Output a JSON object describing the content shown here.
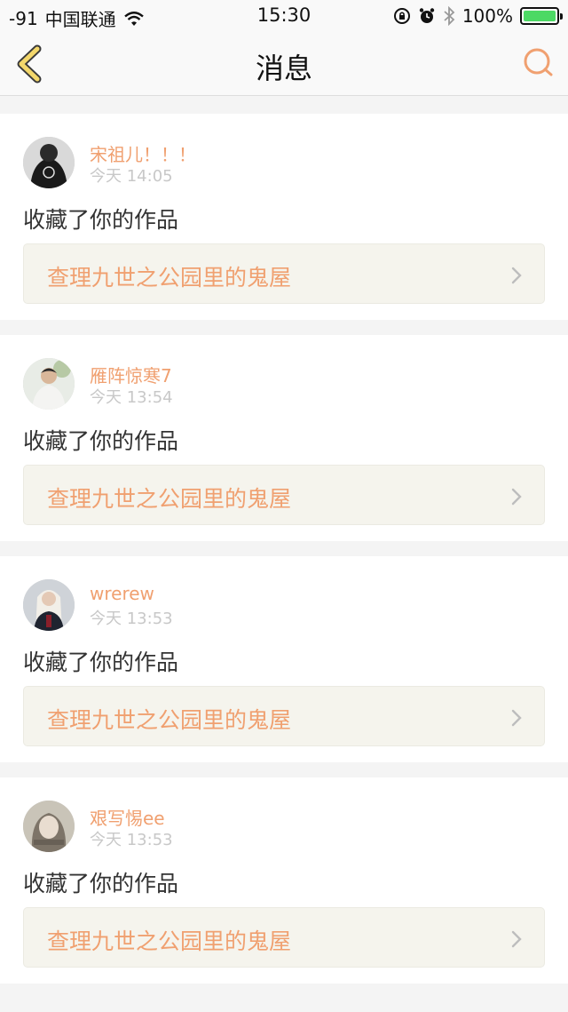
{
  "status": {
    "signal": "-91",
    "carrier": "中国联通",
    "time": "15:30",
    "battery": "100%",
    "battery_level": 1.0
  },
  "nav": {
    "title": "消息",
    "accent": "#f0a070"
  },
  "messages": [
    {
      "user": "宋祖儿！！！",
      "time": "今天 14:05",
      "action": "收藏了你的作品",
      "work": "查理九世之公园里的鬼屋"
    },
    {
      "user": "雁阵惊寒7",
      "time": "今天 13:54",
      "action": "收藏了你的作品",
      "work": "查理九世之公园里的鬼屋"
    },
    {
      "user": "wrerew",
      "time": "今天 13:53",
      "action": "收藏了你的作品",
      "work": "查理九世之公园里的鬼屋"
    },
    {
      "user": "艰写惕ee",
      "time": "今天 13:53",
      "action": "收藏了你的作品",
      "work": "查理九世之公园里的鬼屋"
    }
  ]
}
